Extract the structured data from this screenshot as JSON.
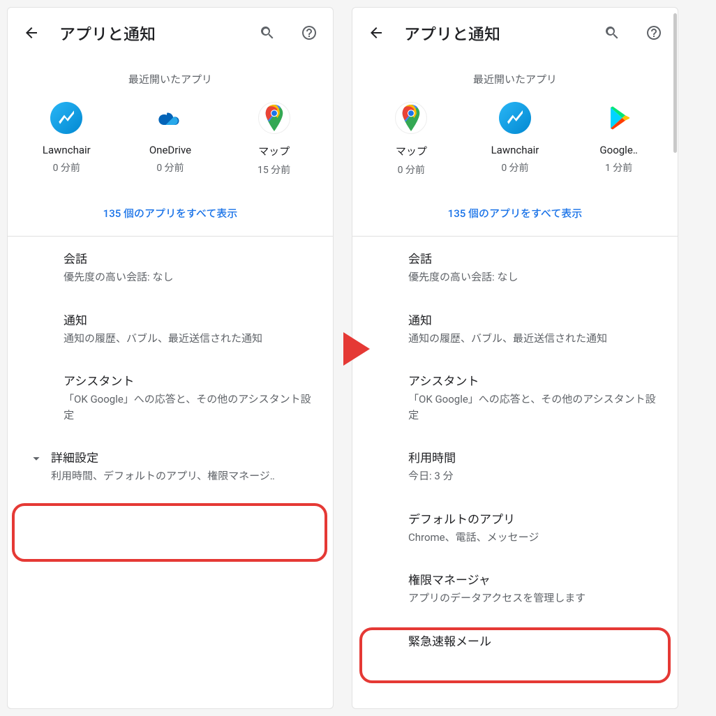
{
  "screens": {
    "left": {
      "title": "アプリと通知",
      "recent_label": "最近開いたアプリ",
      "apps": [
        {
          "name": "Lawnchair",
          "time": "0 分前",
          "icon": "lawnchair"
        },
        {
          "name": "OneDrive",
          "time": "0 分前",
          "icon": "onedrive"
        },
        {
          "name": "マップ",
          "time": "15 分前",
          "icon": "maps"
        }
      ],
      "see_all": "135 個のアプリをすべて表示",
      "items": [
        {
          "title": "会話",
          "sub": "優先度の高い会話: なし"
        },
        {
          "title": "通知",
          "sub": "通知の履歴、バブル、最近送信された通知"
        },
        {
          "title": "アシスタント",
          "sub": "「OK Google」への応答と、その他のアシスタント設定"
        }
      ],
      "advanced": {
        "title": "詳細設定",
        "sub": "利用時間、デフォルトのアプリ、権限マネージ‥"
      }
    },
    "right": {
      "title": "アプリと通知",
      "recent_label": "最近開いたアプリ",
      "apps": [
        {
          "name": "マップ",
          "time": "0 分前",
          "icon": "maps"
        },
        {
          "name": "Lawnchair",
          "time": "0 分前",
          "icon": "lawnchair"
        },
        {
          "name": "Google‥",
          "time": "1 分前",
          "icon": "play"
        }
      ],
      "see_all": "135 個のアプリをすべて表示",
      "items": [
        {
          "title": "会話",
          "sub": "優先度の高い会話: なし"
        },
        {
          "title": "通知",
          "sub": "通知の履歴、バブル、最近送信された通知"
        },
        {
          "title": "アシスタント",
          "sub": "「OK Google」への応答と、その他のアシスタント設定"
        },
        {
          "title": "利用時間",
          "sub": "今日: 3 分"
        },
        {
          "title": "デフォルトのアプリ",
          "sub": "Chrome、電話、メッセージ"
        },
        {
          "title": "権限マネージャ",
          "sub": "アプリのデータアクセスを管理します"
        },
        {
          "title": "緊急速報メール",
          "sub": ""
        }
      ]
    }
  },
  "colors": {
    "accent": "#1a73e8",
    "highlight": "#e53935"
  }
}
